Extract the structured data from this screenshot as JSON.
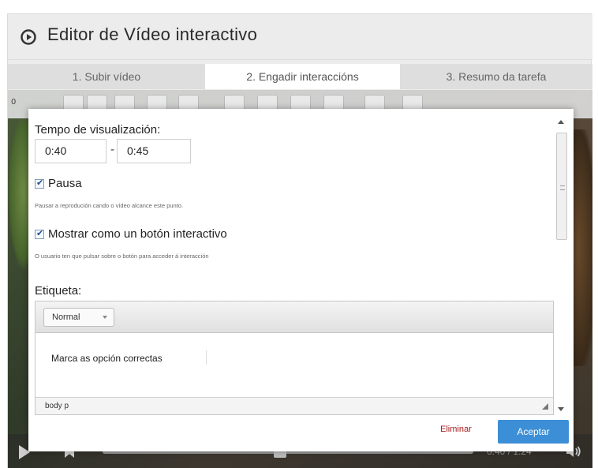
{
  "header": {
    "title": "Editor de Vídeo interactivo",
    "icon": "play-circle-icon"
  },
  "tabs": [
    {
      "label": "1. Subir vídeo"
    },
    {
      "label": "2. Engadir interaccións",
      "active": true
    },
    {
      "label": "3. Resumo da tarefa"
    }
  ],
  "video": {
    "toolbar_time": "0",
    "toolbar_icons": [
      "text-icon",
      "table-icon",
      "link-icon",
      "image-icon",
      "statements-icon",
      "list-icon",
      "checklist-icon",
      "fill-blanks-icon",
      "speech-icon",
      "drag-words-icon",
      "summary-icon"
    ],
    "time_display": "0:40 / 1:24"
  },
  "modal": {
    "display_time_label": "Tempo de visualización:",
    "time_from": "0:40",
    "time_dash": "-",
    "time_to": "0:45",
    "pause_label": "Pausa",
    "pause_checked": true,
    "pause_hint": "Pausar a reprodución cando o vídeo alcance este punto.",
    "button_label": "Mostrar como un botón interactivo",
    "button_checked": true,
    "button_hint": "O usuario ten que pulsar sobre o botón para acceder á interacción",
    "label_title": "Etiqueta:",
    "format_select": "Normal",
    "editor_text": "Marca as opción correctas",
    "status_path": "body  p",
    "delete_label": "Eliminar",
    "accept_label": "Aceptar"
  },
  "colors": {
    "accept": "#3c8fd6",
    "delete": "#a21b1b"
  }
}
